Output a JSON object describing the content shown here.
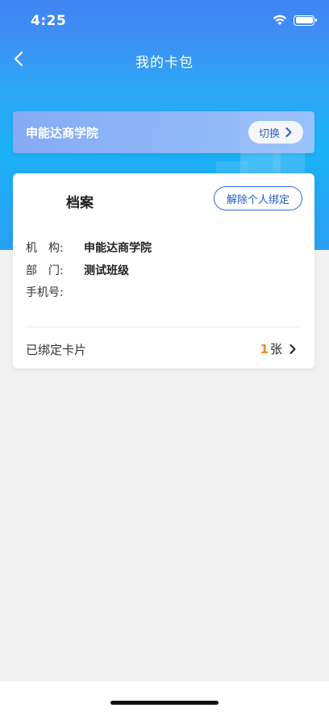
{
  "status_bar": {
    "time": "4:25",
    "icons": [
      "wifi-icon",
      "battery-icon"
    ]
  },
  "nav": {
    "title": "我的卡包",
    "back_icon": "chevron-left-icon"
  },
  "institution_card": {
    "name": "申能达商学院",
    "switch_label": "切换"
  },
  "profile_card": {
    "title": "档案",
    "unbind_label": "解除个人绑定",
    "fields": [
      {
        "label": "机　构:",
        "value": "申能达商学院"
      },
      {
        "label": "部　门:",
        "value": "测试班级"
      },
      {
        "label": "手机号:",
        "value": ""
      }
    ],
    "bound_cards_label": "已绑定卡片",
    "bound_cards_count": "1",
    "bound_cards_unit": "张"
  },
  "colors": {
    "header_blue": "#3f86f3",
    "accent_orange": "#f08a1f",
    "button_blue": "#2d6fdc"
  }
}
